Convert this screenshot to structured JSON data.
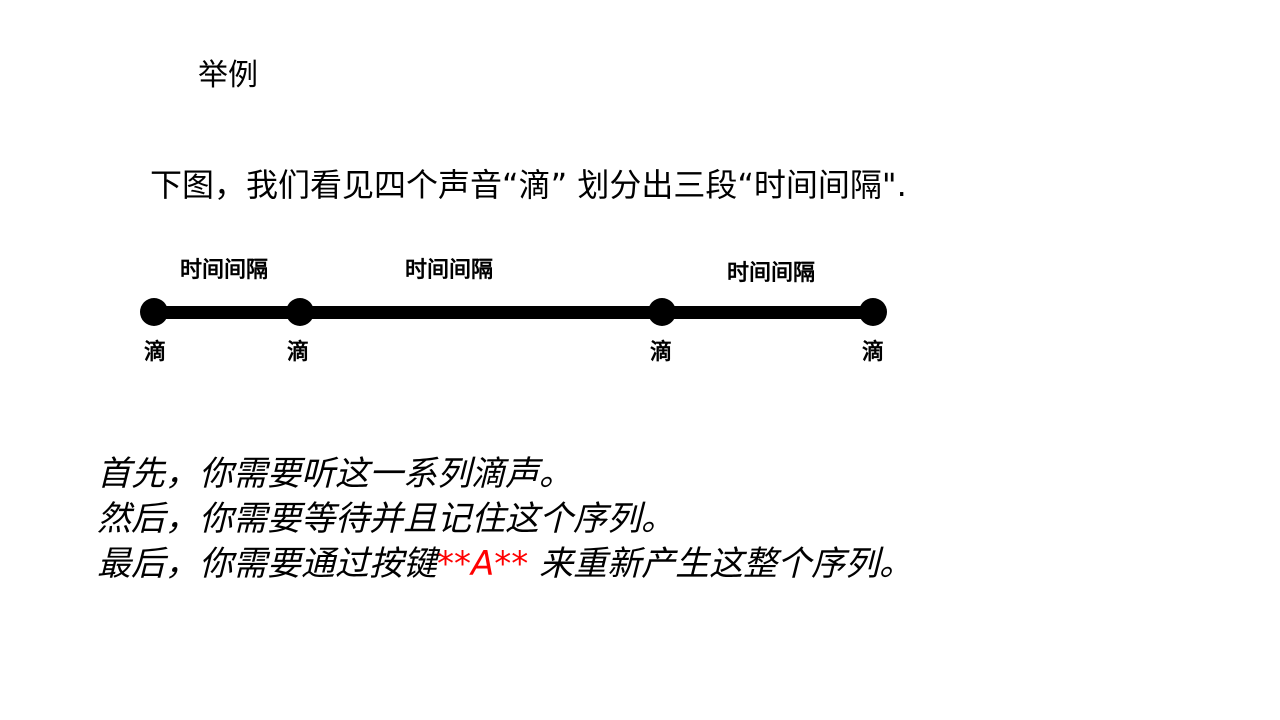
{
  "slide": {
    "title": "举例",
    "intro": "下图，我们看见四个声音“滴” 划分出三段“时间间隔\"."
  },
  "timeline": {
    "drip_labels": [
      "滴",
      "滴",
      "滴",
      "滴"
    ],
    "interval_labels": [
      "时间间隔",
      "时间间隔",
      "时间间隔"
    ]
  },
  "instructions": {
    "line1": "首先，你需要听这一系列滴声。",
    "line2": "然后，你需要等待并且记住这个序列。",
    "line3_prefix": "最后，你需要通过按键",
    "line3_key": "**A**",
    "line3_suffix": " 来重新产生这整个序列。"
  },
  "colors": {
    "text": "#000000",
    "key_highlight": "#ff0000",
    "background": "#ffffff"
  }
}
